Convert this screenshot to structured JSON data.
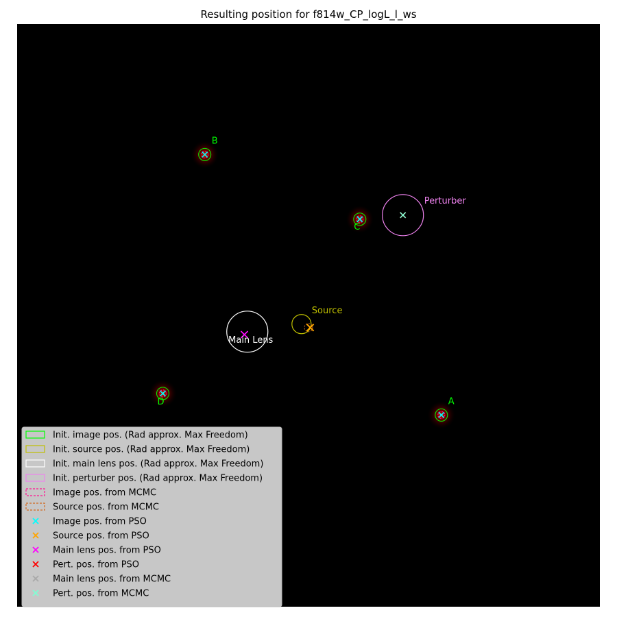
{
  "title": "Resulting position for f814w_CP_logL_l_ws",
  "chart_data": {
    "type": "scatter",
    "title": "Resulting position for f814w_CP_logL_l_ws",
    "xlim": [
      0,
      1
    ],
    "ylim": [
      0,
      1
    ],
    "grid": false,
    "background": "#000000",
    "legend_placement": "lower-left",
    "images": [
      {
        "label": "A",
        "x": 0.728,
        "y": 0.329
      },
      {
        "label": "B",
        "x": 0.322,
        "y": 0.776
      },
      {
        "label": "C",
        "x": 0.588,
        "y": 0.665
      },
      {
        "label": "D",
        "x": 0.25,
        "y": 0.366
      }
    ],
    "source": {
      "label": "Source",
      "init": {
        "x": 0.488,
        "y": 0.485
      },
      "mcmc": {
        "x": 0.5,
        "y": 0.479
      },
      "pso": {
        "x": 0.503,
        "y": 0.479
      }
    },
    "main_lens": {
      "label": "Main Lens",
      "init": {
        "x": 0.395,
        "y": 0.472
      },
      "pso": {
        "x": 0.39,
        "y": 0.467
      },
      "mcmc": {
        "x": 0.39,
        "y": 0.467
      }
    },
    "perturber": {
      "label": "Perturber",
      "init": {
        "x": 0.662,
        "y": 0.672
      },
      "pso": {
        "x": 0.662,
        "y": 0.672
      },
      "mcmc": {
        "x": 0.662,
        "y": 0.672
      }
    },
    "legend": [
      {
        "label": "Init. image pos. (Rad approx. Max Freedom)",
        "kind": "patch",
        "color": "#00ff00",
        "style": "solid"
      },
      {
        "label": "Init. source pos. (Rad approx. Max Freedom)",
        "kind": "patch",
        "color": "#bfbf00",
        "style": "solid"
      },
      {
        "label": "Init. main lens pos. (Rad approx. Max Freedom)",
        "kind": "patch",
        "color": "#ffffff",
        "style": "solid"
      },
      {
        "label": "Init. perturber pos. (Rad approx. Max Freedom)",
        "kind": "patch",
        "color": "#ee82ee",
        "style": "solid"
      },
      {
        "label": "Image pos. from MCMC",
        "kind": "patch",
        "color": "#ff1493",
        "style": "dashed"
      },
      {
        "label": "Source pos. from MCMC",
        "kind": "patch",
        "color": "#d2691e",
        "style": "dashed"
      },
      {
        "label": "Image pos. from PSO",
        "kind": "marker",
        "color": "#00ffff"
      },
      {
        "label": "Source pos. from PSO",
        "kind": "marker",
        "color": "#ffa500"
      },
      {
        "label": "Main lens pos. from PSO",
        "kind": "marker",
        "color": "#ff00ff"
      },
      {
        "label": "Pert. pos. from PSO",
        "kind": "marker",
        "color": "#ff0000"
      },
      {
        "label": "Main lens pos. from MCMC",
        "kind": "marker",
        "color": "#a9a9a9"
      },
      {
        "label": "Pert. pos. from MCMC",
        "kind": "marker",
        "color": "#7fffd4"
      }
    ]
  }
}
